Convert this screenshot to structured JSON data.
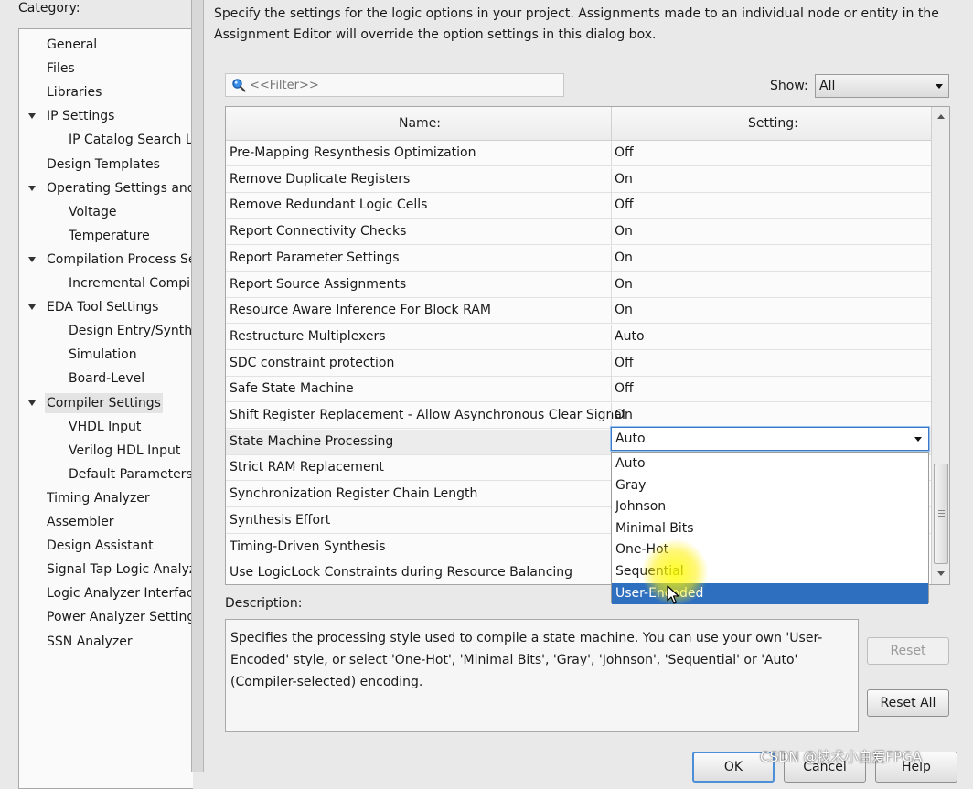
{
  "category_label": "Category:",
  "intro_text": "Specify the settings for the logic options in your project.  Assignments made to an individual node or entity in the Assignment Editor will override the option settings in this dialog box.",
  "filter": {
    "placeholder": "<<Filter>>"
  },
  "show": {
    "label": "Show:",
    "value": "All"
  },
  "categories": [
    {
      "label": "General",
      "indent": 0,
      "expanded": false,
      "selected": false
    },
    {
      "label": "Files",
      "indent": 0,
      "expanded": false,
      "selected": false
    },
    {
      "label": "Libraries",
      "indent": 0,
      "expanded": false,
      "selected": false
    },
    {
      "label": "IP Settings",
      "indent": 0,
      "expanded": true,
      "selected": false
    },
    {
      "label": "IP Catalog Search Lo",
      "indent": 1,
      "expanded": false,
      "selected": false
    },
    {
      "label": "Design Templates",
      "indent": 0,
      "expanded": false,
      "selected": false
    },
    {
      "label": "Operating Settings and C",
      "indent": 0,
      "expanded": true,
      "selected": false
    },
    {
      "label": "Voltage",
      "indent": 1,
      "expanded": false,
      "selected": false
    },
    {
      "label": "Temperature",
      "indent": 1,
      "expanded": false,
      "selected": false
    },
    {
      "label": "Compilation Process Se",
      "indent": 0,
      "expanded": true,
      "selected": false
    },
    {
      "label": "Incremental Compila",
      "indent": 1,
      "expanded": false,
      "selected": false
    },
    {
      "label": "EDA Tool Settings",
      "indent": 0,
      "expanded": true,
      "selected": false
    },
    {
      "label": "Design Entry/Synthe",
      "indent": 1,
      "expanded": false,
      "selected": false
    },
    {
      "label": "Simulation",
      "indent": 1,
      "expanded": false,
      "selected": false
    },
    {
      "label": "Board-Level",
      "indent": 1,
      "expanded": false,
      "selected": false
    },
    {
      "label": "Compiler Settings",
      "indent": 0,
      "expanded": true,
      "selected": true
    },
    {
      "label": "VHDL Input",
      "indent": 1,
      "expanded": false,
      "selected": false
    },
    {
      "label": "Verilog HDL Input",
      "indent": 1,
      "expanded": false,
      "selected": false
    },
    {
      "label": "Default Parameters",
      "indent": 1,
      "expanded": false,
      "selected": false
    },
    {
      "label": "Timing Analyzer",
      "indent": 0,
      "expanded": false,
      "selected": false
    },
    {
      "label": "Assembler",
      "indent": 0,
      "expanded": false,
      "selected": false
    },
    {
      "label": "Design Assistant",
      "indent": 0,
      "expanded": false,
      "selected": false
    },
    {
      "label": "Signal Tap Logic Analyze",
      "indent": 0,
      "expanded": false,
      "selected": false
    },
    {
      "label": "Logic Analyzer Interface",
      "indent": 0,
      "expanded": false,
      "selected": false
    },
    {
      "label": "Power Analyzer Settings",
      "indent": 0,
      "expanded": false,
      "selected": false
    },
    {
      "label": "SSN Analyzer",
      "indent": 0,
      "expanded": false,
      "selected": false
    }
  ],
  "table": {
    "columns": [
      "Name:",
      "Setting:"
    ],
    "rows": [
      {
        "name": "Pre-Mapping Resynthesis Optimization",
        "setting": "Off"
      },
      {
        "name": "Remove Duplicate Registers",
        "setting": "On"
      },
      {
        "name": "Remove Redundant Logic Cells",
        "setting": "Off"
      },
      {
        "name": "Report Connectivity Checks",
        "setting": "On"
      },
      {
        "name": "Report Parameter Settings",
        "setting": "On"
      },
      {
        "name": "Report Source Assignments",
        "setting": "On"
      },
      {
        "name": "Resource Aware Inference For Block RAM",
        "setting": "On"
      },
      {
        "name": "Restructure Multiplexers",
        "setting": "Auto"
      },
      {
        "name": "SDC constraint protection",
        "setting": "Off"
      },
      {
        "name": "Safe State Machine",
        "setting": "Off"
      },
      {
        "name": "Shift Register Replacement - Allow Asynchronous Clear Signal",
        "setting": "On"
      },
      {
        "name": "State Machine Processing",
        "setting": "",
        "active": true
      },
      {
        "name": "Strict RAM Replacement",
        "setting": ""
      },
      {
        "name": "Synchronization Register Chain Length",
        "setting": ""
      },
      {
        "name": "Synthesis Effort",
        "setting": ""
      },
      {
        "name": "Timing-Driven Synthesis",
        "setting": ""
      },
      {
        "name": "Use LogicLock Constraints during Resource Balancing",
        "setting": ""
      }
    ]
  },
  "combo": {
    "value": "Auto",
    "options": [
      "Auto",
      "Gray",
      "Johnson",
      "Minimal Bits",
      "One-Hot",
      "Sequential",
      "User-Encoded"
    ],
    "highlighted_index": 6
  },
  "description": {
    "label": "Description:",
    "text": "Specifies the processing style used to compile a state machine. You can use your own 'User-Encoded' style, or select 'One-Hot', 'Minimal Bits', 'Gray', 'Johnson', 'Sequential' or 'Auto' (Compiler-selected) encoding."
  },
  "buttons": {
    "reset": "Reset",
    "reset_all": "Reset All",
    "ok": "OK",
    "cancel": "Cancel",
    "help": "Help"
  },
  "watermark": "CSDN @技术小白爱FPGA",
  "colors": {
    "highlight": "#2f6fc0",
    "focus": "#3a78c4",
    "cursor_glow": "#ffff00"
  }
}
